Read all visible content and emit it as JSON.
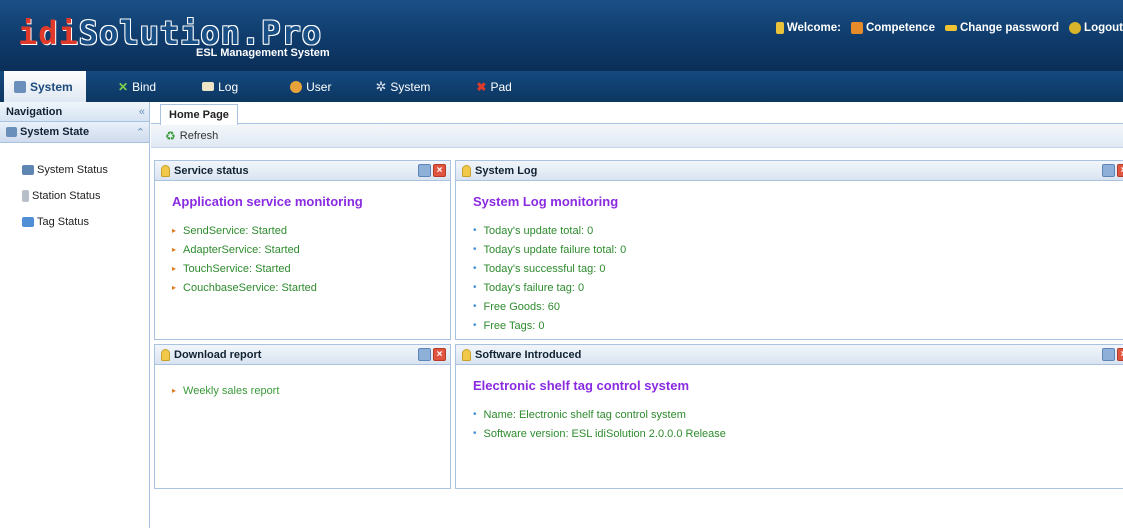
{
  "header": {
    "logo_idi": "idi",
    "logo_rest": "Solution.Pro",
    "subtitle": "ESL Management System",
    "welcome": "Welcome:",
    "competence": "Competence",
    "change_password": "Change password",
    "logout": "Logout"
  },
  "menubar": {
    "items": [
      {
        "label": "System",
        "icon": "system-icon"
      },
      {
        "label": "Bind",
        "icon": "bind-icon"
      },
      {
        "label": "Log",
        "icon": "log-icon"
      },
      {
        "label": "User",
        "icon": "user-icon"
      },
      {
        "label": "System",
        "icon": "gear-icon"
      },
      {
        "label": "Pad",
        "icon": "pad-icon"
      }
    ]
  },
  "sidebar": {
    "nav_title": "Navigation",
    "section_title": "System State",
    "items": [
      {
        "label": "System Status",
        "icon": "monitor-icon"
      },
      {
        "label": "Station Status",
        "icon": "station-icon"
      },
      {
        "label": "Tag Status",
        "icon": "tag-icon"
      }
    ]
  },
  "tabs": {
    "home": "Home Page"
  },
  "toolbar": {
    "refresh": "Refresh"
  },
  "panels": {
    "service": {
      "header": "Service status",
      "title": "Application service monitoring",
      "items": [
        "SendService: Started",
        "AdapterService: Started",
        "TouchService: Started",
        "CouchbaseService: Started"
      ]
    },
    "log": {
      "header": "System Log",
      "title": "System Log monitoring",
      "items": [
        "Today's update total: 0",
        "Today's update failure total: 0",
        "Today's successful tag: 0",
        "Today's failure tag: 0",
        "Free Goods: 60",
        "Free Tags: 0"
      ]
    },
    "download": {
      "header": "Download report",
      "items": [
        "Weekly sales report"
      ]
    },
    "software": {
      "header": "Software Introduced",
      "title": "Electronic shelf tag control system",
      "items": [
        "Name: Electronic shelf tag control system",
        "Software version: ESL idiSolution 2.0.0.0 Release"
      ]
    }
  },
  "colors": {
    "header_bg": "#0f3b6b",
    "accent_purple": "#8a2be2",
    "item_green": "#2e8b2e",
    "border": "#a8c2df"
  }
}
